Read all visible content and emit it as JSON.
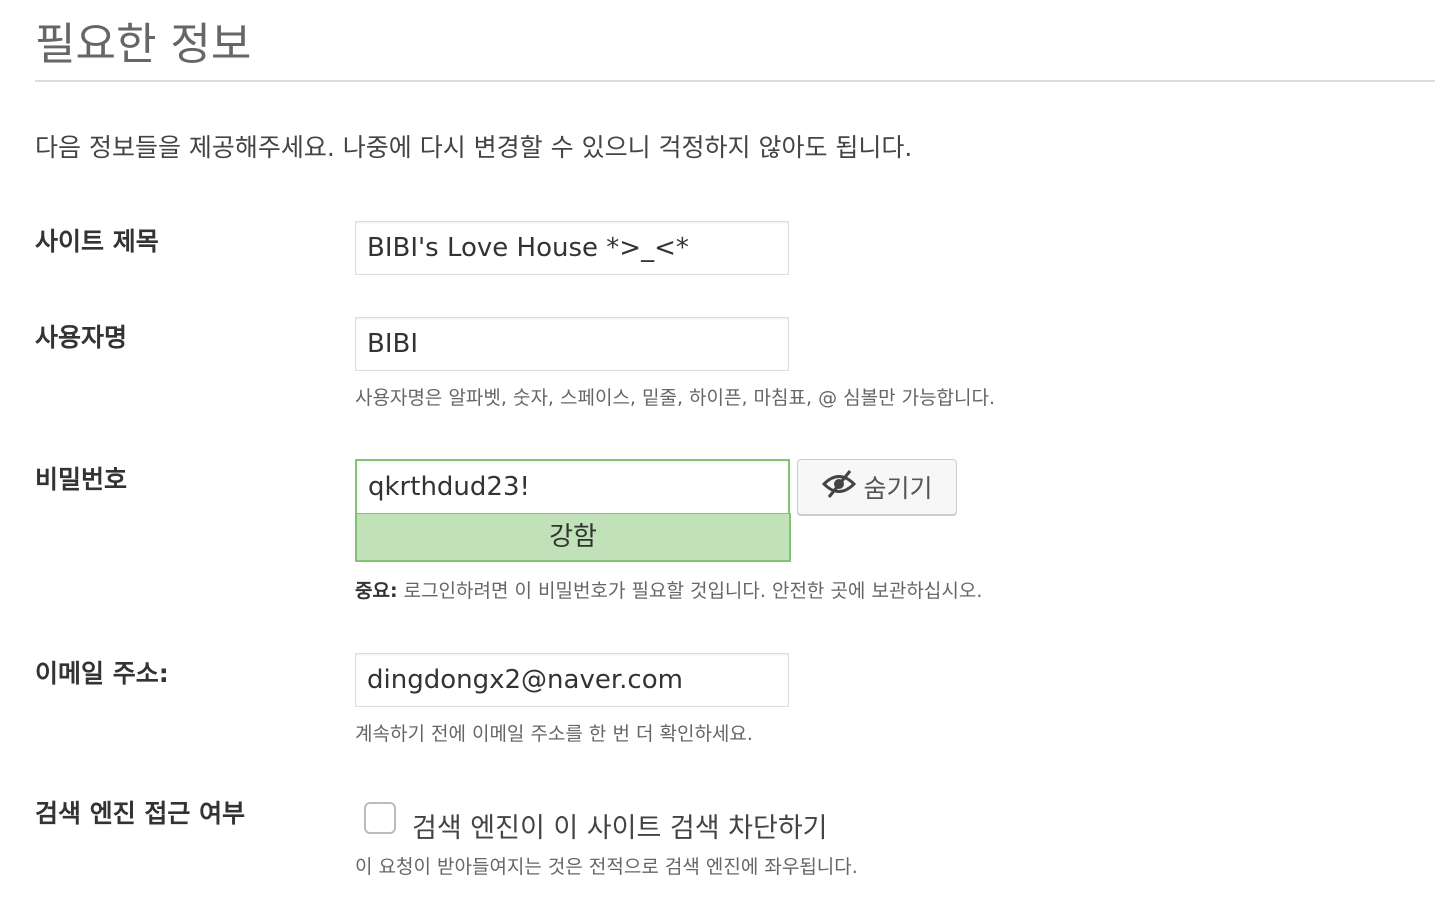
{
  "title": "필요한 정보",
  "intro": "다음 정보들을 제공해주세요. 나중에 다시 변경할 수 있으니 걱정하지 않아도 됩니다.",
  "site_title": {
    "label": "사이트 제목",
    "value": "BIBI's Love House *>_<*"
  },
  "username": {
    "label": "사용자명",
    "value": "BIBI",
    "description": "사용자명은 알파벳, 숫자, 스페이스, 밑줄, 하이픈, 마침표, @ 심볼만 가능합니다."
  },
  "password": {
    "label": "비밀번호",
    "value": "qkrthdud23!",
    "strength": "강함",
    "hide_label": "숨기기",
    "note_strong": "중요:",
    "note": " 로그인하려면 이 비밀번호가 필요할 것입니다. 안전한 곳에 보관하십시오."
  },
  "email": {
    "label": "이메일 주소:",
    "value": "dingdongx2@naver.com",
    "description": "계속하기 전에 이메일 주소를 한 번 더 확인하세요."
  },
  "search": {
    "label": "검색 엔진 접근 여부",
    "checkbox_label": "검색 엔진이 이 사이트 검색 차단하기",
    "checked": false,
    "description": "이 요청이 받아들여지는 것은 전적으로 검색 엔진에 좌우됩니다."
  }
}
